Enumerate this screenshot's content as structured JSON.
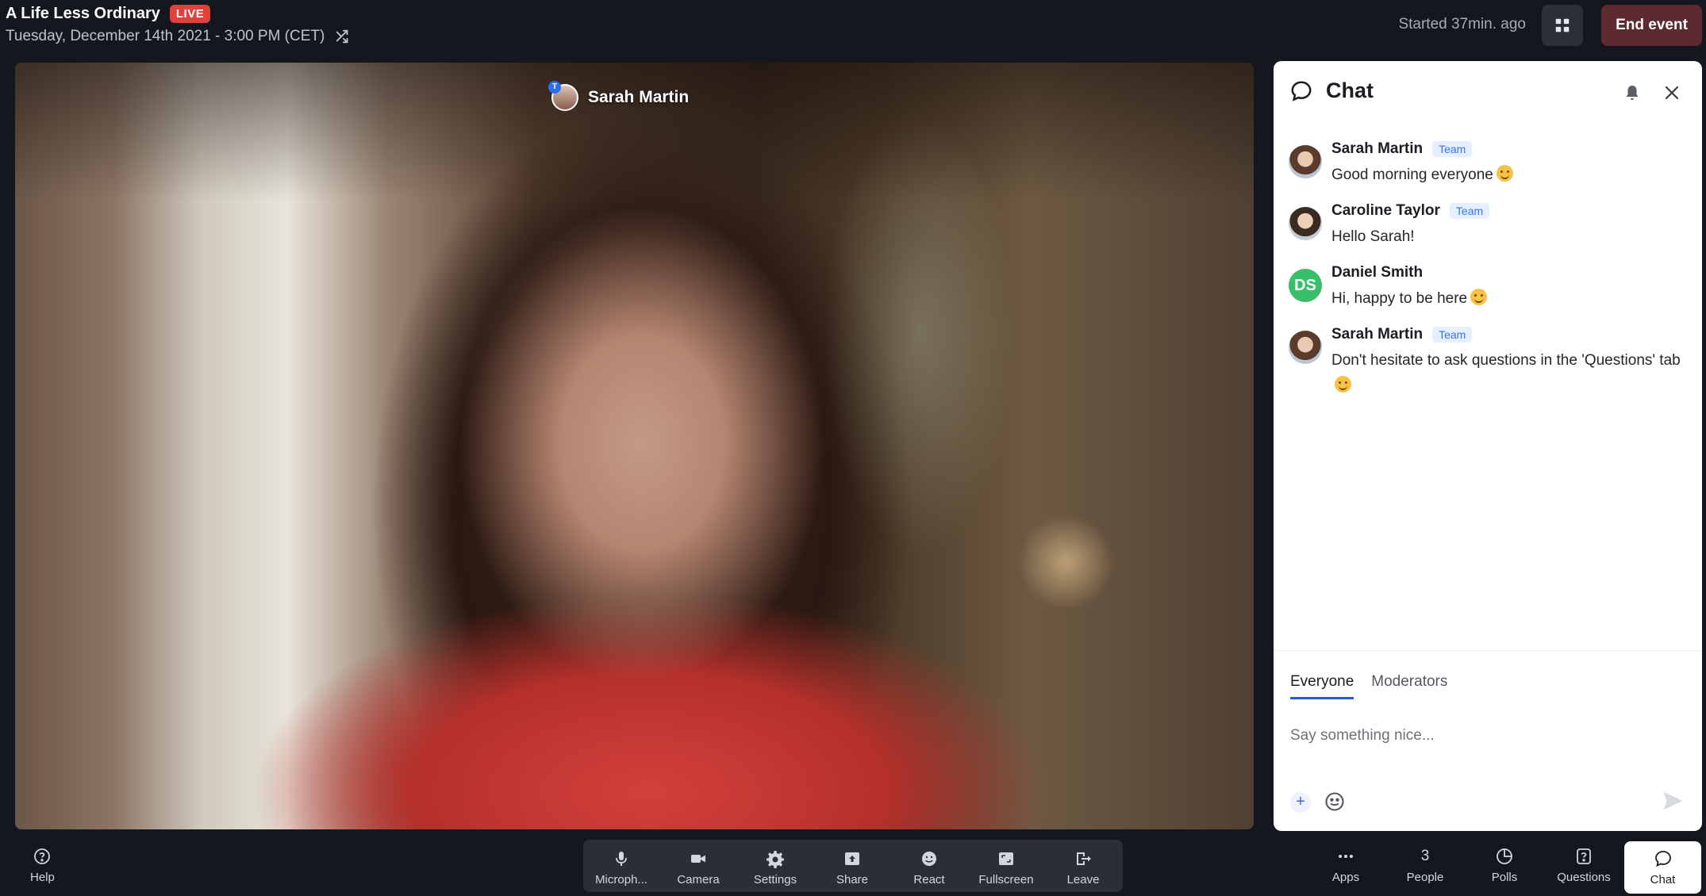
{
  "header": {
    "event_title": "A Life Less Ordinary",
    "live_label": "LIVE",
    "date_line": "Tuesday, December 14th 2021 - 3:00 PM (CET)",
    "started_text": "Started 37min. ago",
    "end_event_label": "End event",
    "colors": {
      "live": "#e0413c",
      "end_event_bg": "#5d2a30"
    }
  },
  "stage": {
    "speaker_name": "Sarah Martin",
    "speaker_badge": "T"
  },
  "chat": {
    "title": "Chat",
    "messages": [
      {
        "author": "Sarah Martin",
        "badge": "Team",
        "text": "Good morning everyone",
        "emoji": "smiling-face"
      },
      {
        "author": "Caroline Taylor",
        "badge": "Team",
        "text": "Hello Sarah!"
      },
      {
        "author": "Daniel Smith",
        "initials": "DS",
        "text": "Hi, happy to be here",
        "emoji": "grinning-face"
      },
      {
        "author": "Sarah Martin",
        "badge": "Team",
        "text": "Don't hesitate to ask questions in the 'Questions' tab",
        "emoji": "winking-face"
      }
    ],
    "tabs": [
      "Everyone",
      "Moderators"
    ],
    "active_tab": "Everyone",
    "input_placeholder": "Say something nice...",
    "accent": "#2a5bd7"
  },
  "toolbar": {
    "help_label": "Help",
    "center": [
      "Microph...",
      "Camera",
      "Settings",
      "Share",
      "React",
      "Fullscreen",
      "Leave"
    ],
    "right": {
      "apps_label": "Apps",
      "people_count": "3",
      "people_label": "People",
      "polls_label": "Polls",
      "questions_label": "Questions",
      "chat_label": "Chat"
    }
  }
}
